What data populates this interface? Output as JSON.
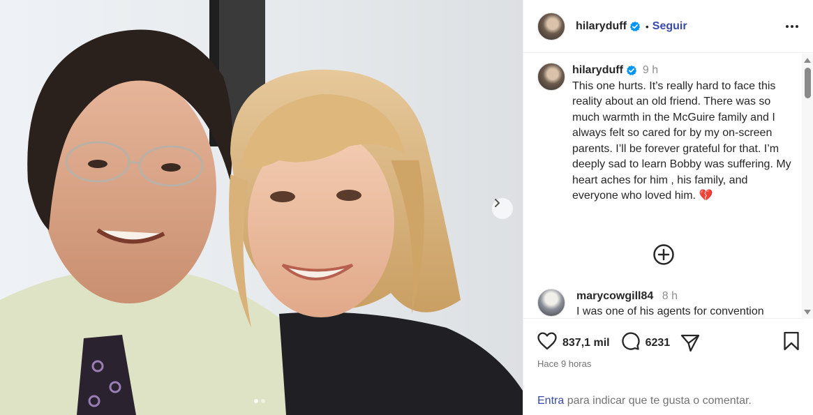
{
  "post": {
    "username": "hilaryduff",
    "follow_label": "Seguir",
    "dot": "•",
    "caption": {
      "username": "hilaryduff",
      "time": "9 h",
      "text": "This one hurts. It’s really hard to face this reality about an old friend. There was so much warmth in the McGuire family and I always felt so cared for by my on-screen parents. I’ll be forever grateful for that. I’m deeply sad to learn Bobby was suffering. My heart aches for him , his family, and everyone who loved him.",
      "emoji": "💔"
    },
    "comment": {
      "username": "marycowgill84",
      "time": "8 h",
      "text": "I was one of his agents for convention"
    },
    "likes": "837,1 mil",
    "comments_count": "6231",
    "posted": "Hace 9 horas"
  },
  "footer": {
    "login_link": "Entra",
    "login_text": " para indicar que te gusta o comentar."
  },
  "icons": {
    "verified": "verified-badge-icon",
    "more": "more-options-icon",
    "add": "load-more-comments-icon",
    "like": "heart-icon",
    "comment": "comment-icon",
    "share": "share-icon",
    "save": "bookmark-icon",
    "next": "chevron-right-icon"
  },
  "colors": {
    "verified": "#0095f6",
    "link": "#3949ab",
    "muted": "#737373"
  }
}
